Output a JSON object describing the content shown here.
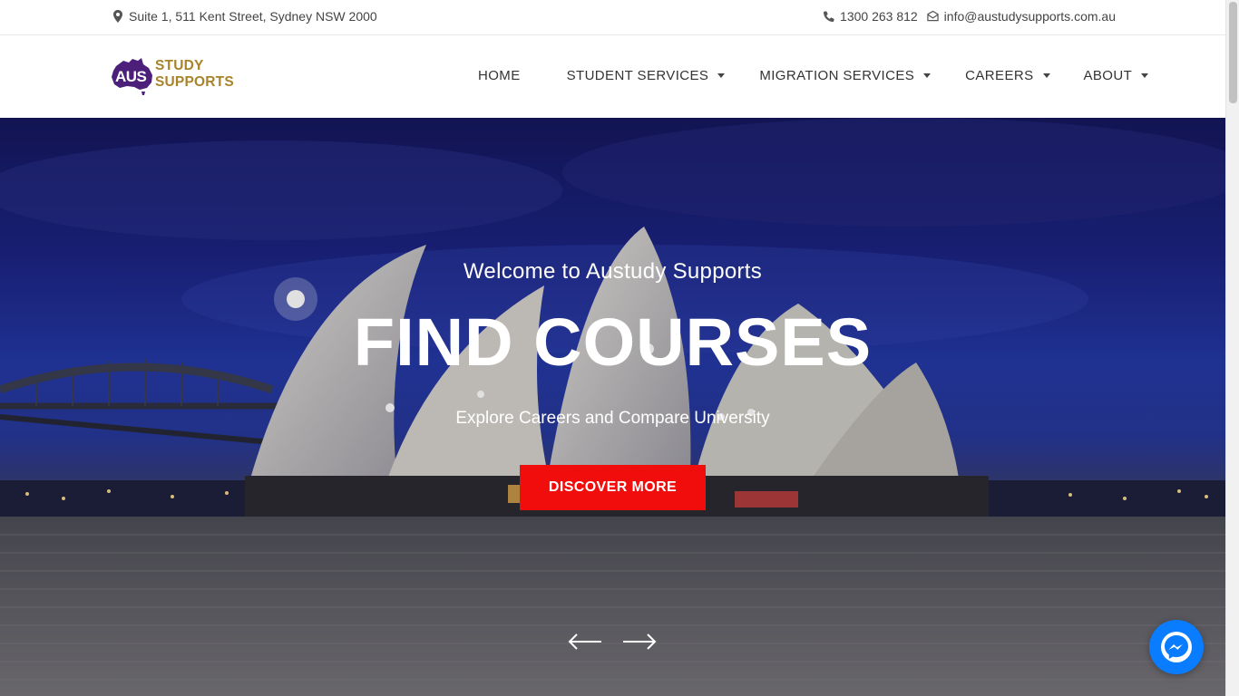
{
  "topbar": {
    "address": "Suite 1, 511 Kent Street, Sydney NSW 2000",
    "phone": "1300 263 812",
    "email": "info@austudysupports.com.au",
    "icons": {
      "address": "map-pin-icon",
      "phone": "phone-icon",
      "email": "envelope-icon"
    }
  },
  "logo": {
    "badge_text": "AUS",
    "text": "STUDY SUPPORTS",
    "colors": {
      "badge": "#4b1f7a",
      "text": "#a8832a"
    }
  },
  "nav": {
    "items": [
      {
        "label": "HOME",
        "dropdown": false
      },
      {
        "label": "STUDENT SERVICES",
        "dropdown": true
      },
      {
        "label": "MIGRATION SERVICES",
        "dropdown": true
      },
      {
        "label": "CAREERS",
        "dropdown": true
      },
      {
        "label": "ABOUT",
        "dropdown": true
      }
    ]
  },
  "hero": {
    "welcome": "Welcome to Austudy Supports",
    "title": "FIND COURSES",
    "subtitle": "Explore Careers and Compare University",
    "button_label": "DISCOVER MORE",
    "button_color": "#f20d0d",
    "prev_icon": "arrow-left-icon",
    "next_icon": "arrow-right-icon"
  },
  "messenger": {
    "icon": "messenger-icon",
    "color": "#0a7cff"
  }
}
